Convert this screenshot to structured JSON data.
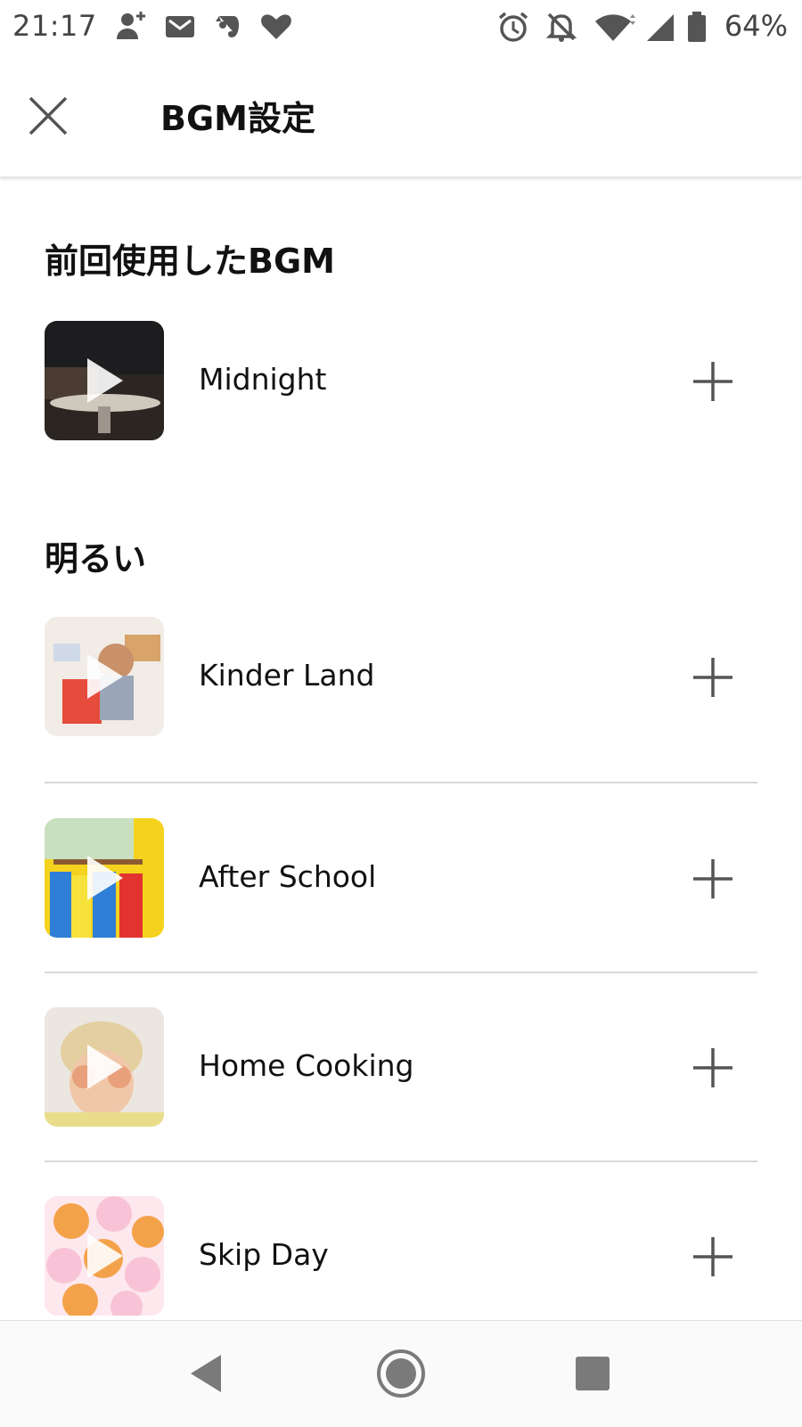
{
  "status_bar": {
    "time": "21:17",
    "battery_percent": "64%",
    "icons": [
      "add-person-icon",
      "gmail-icon",
      "evernote-icon",
      "heart-icon",
      "alarm-icon",
      "bell-off-icon",
      "wifi-icon",
      "signal-icon",
      "battery-icon"
    ]
  },
  "header": {
    "title": "BGM設定",
    "close_icon": "close-icon"
  },
  "sections": [
    {
      "title": "前回使用したBGM",
      "items": [
        {
          "name": "Midnight",
          "thumb_colors": [
            "#1d1d1f",
            "#4a3c33"
          ]
        }
      ]
    },
    {
      "title": "明るい",
      "items": [
        {
          "name": "Kinder Land",
          "thumb_colors": [
            "#f1ece6",
            "#e64c3c"
          ]
        },
        {
          "name": "After School",
          "thumb_colors": [
            "#f4d21e",
            "#2f7fd8"
          ]
        },
        {
          "name": "Home Cooking",
          "thumb_colors": [
            "#ebe6df",
            "#e7a07a"
          ]
        },
        {
          "name": "Skip Day",
          "thumb_colors": [
            "#f8c3d6",
            "#f4a24a"
          ]
        }
      ]
    }
  ],
  "nav_bar": {
    "buttons": [
      "back-icon",
      "home-icon",
      "recents-icon"
    ]
  }
}
